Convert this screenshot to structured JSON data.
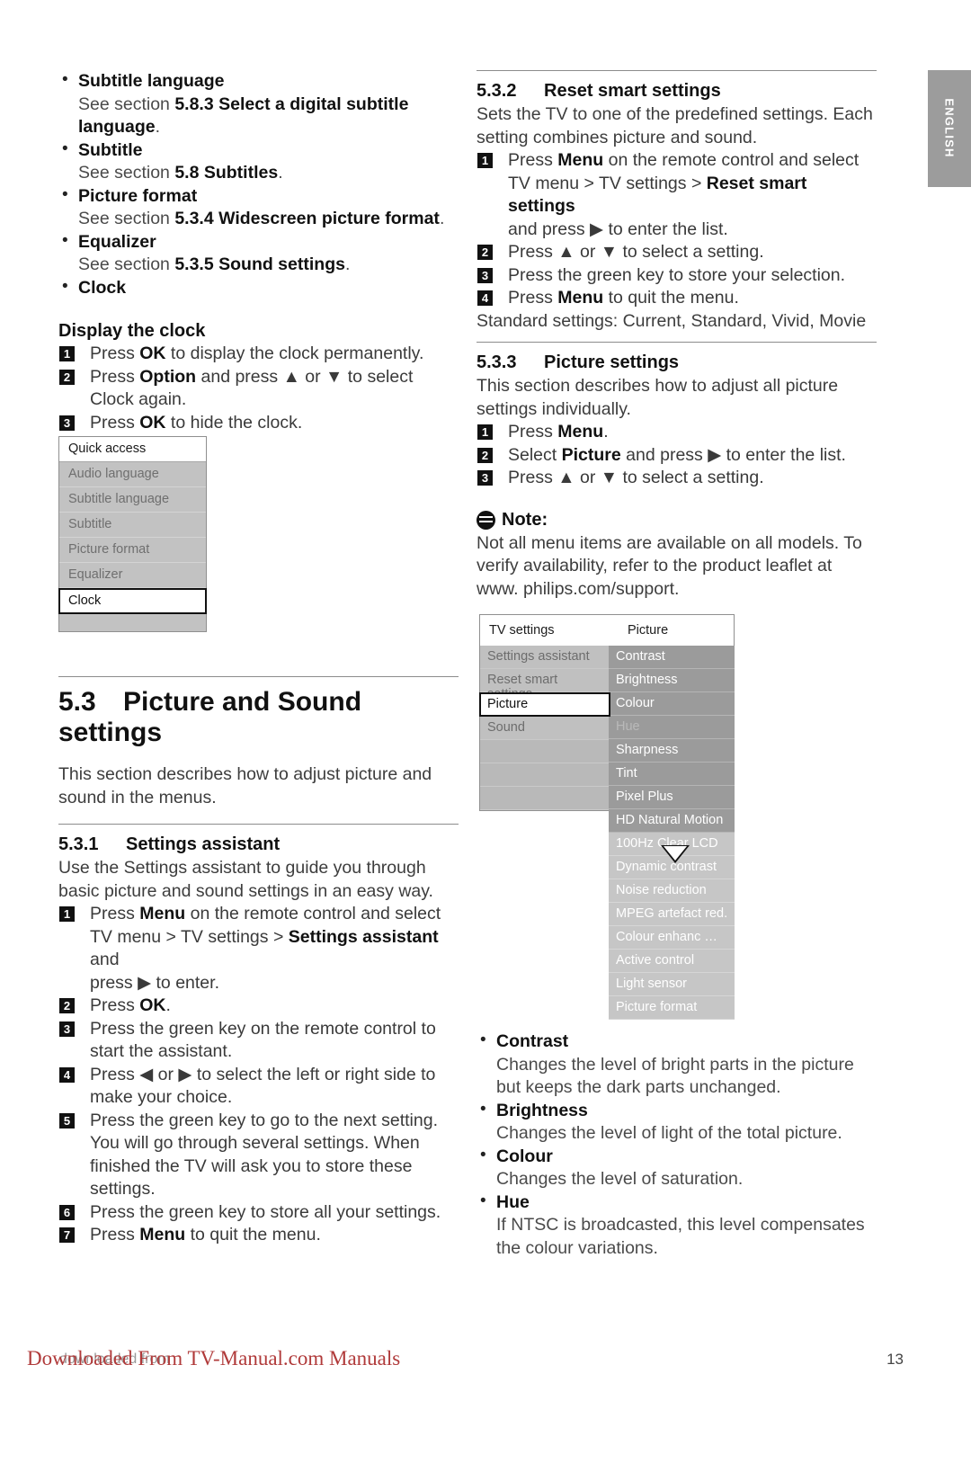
{
  "side_tab": {
    "label": "ENGLISH"
  },
  "left_column": {
    "top_bullets": [
      {
        "title": "Subtitle language",
        "sub_plain_1": "See section ",
        "sub_bold": "5.8.3 Select a digital subtitle language",
        "sub_plain_2": "."
      },
      {
        "title": "Subtitle",
        "sub_plain_1": "See section ",
        "sub_bold": "5.8 Subtitles",
        "sub_plain_2": "."
      },
      {
        "title": "Picture format",
        "sub_plain_1": "See section ",
        "sub_bold": "5.3.4 Widescreen picture format",
        "sub_plain_2": "."
      },
      {
        "title": "Equalizer",
        "sub_plain_1": "See section ",
        "sub_bold": "5.3.5 Sound settings",
        "sub_plain_2": "."
      },
      {
        "title": "Clock",
        "sub_plain_1": "",
        "sub_bold": "",
        "sub_plain_2": ""
      }
    ],
    "display_clock": {
      "heading": "Display the clock",
      "steps": [
        {
          "num": "1",
          "line1_a": "Press ",
          "line1_b": "OK",
          "line1_c": " to display the clock permanently."
        },
        {
          "num": "2",
          "line1_a": "Press ",
          "line1_b": "Option",
          "line1_c": " and press ▲ or ▼ to select",
          "line2": "Clock again."
        },
        {
          "num": "3",
          "line1_a": "Press ",
          "line1_b": "OK",
          "line1_c": " to hide the clock."
        }
      ]
    },
    "quick_access_menu": {
      "header": "Quick access",
      "items": [
        {
          "label": "Audio language",
          "selected": false
        },
        {
          "label": "Subtitle language",
          "selected": false
        },
        {
          "label": "Subtitle",
          "selected": false
        },
        {
          "label": "Picture format",
          "selected": false
        },
        {
          "label": "Equalizer",
          "selected": false
        },
        {
          "label": "Clock",
          "selected": true
        }
      ]
    },
    "section_53": {
      "number": "5.3",
      "title": "Picture and Sound settings",
      "intro": "This section describes how to adjust picture and sound in the menus."
    },
    "section_531": {
      "number": "5.3.1",
      "title": "Settings assistant",
      "intro": "Use the Settings assistant to guide you through basic picture and sound settings in an easy way.",
      "steps": [
        {
          "num": "1",
          "a": "Press ",
          "b": "Menu",
          "c": " on the remote control and select",
          "line2_a": "TV menu > TV settings > ",
          "line2_b": "Settings assistant",
          "line2_c": " and",
          "line3": "press ▶ to enter."
        },
        {
          "num": "2",
          "a": "Press ",
          "b": "OK",
          "c": "."
        },
        {
          "num": "3",
          "a": "Press the green key on the remote control to",
          "line2": "start the assistant."
        },
        {
          "num": "4",
          "a": "Press ◀ or ▶ to select the left or right side to",
          "line2": "make your choice."
        },
        {
          "num": "5",
          "a": "Press the green key to go to the next setting.",
          "line2": "You will go through several settings. When",
          "line3": "finished the TV will ask you to store these",
          "line4": "settings."
        },
        {
          "num": "6",
          "a": "Press the green key to store all your settings."
        },
        {
          "num": "7",
          "a": "Press ",
          "b": "Menu",
          "c": " to quit the menu."
        }
      ]
    }
  },
  "right_column": {
    "section_532": {
      "number": "5.3.2",
      "title": "Reset smart settings",
      "intro": "Sets the TV to one of the predefined settings. Each setting combines picture and sound.",
      "steps": [
        {
          "num": "1",
          "a": "Press ",
          "b": "Menu",
          "c": " on the remote control and select",
          "line2_a": "TV menu > TV settings > ",
          "line2_b": "Reset smart settings",
          "line3": "and press ▶ to enter the list."
        },
        {
          "num": "2",
          "a": "Press ▲ or ▼ to select a setting."
        },
        {
          "num": "3",
          "a": "Press the green key to store your selection."
        },
        {
          "num": "4",
          "a": "Press ",
          "b": "Menu",
          "c": " to quit the menu."
        }
      ],
      "footer": "Standard settings: Current, Standard, Vivid, Movie"
    },
    "section_533": {
      "number": "5.3.3",
      "title": "Picture settings",
      "intro": "This section describes how to adjust all picture settings individually.",
      "steps": [
        {
          "num": "1",
          "a": "Press ",
          "b": "Menu",
          "c": "."
        },
        {
          "num": "2",
          "a": "Select ",
          "b": "Picture",
          "c": " and press ▶ to enter the list."
        },
        {
          "num": "3",
          "a": "Press ▲ or ▼ to select a setting."
        }
      ]
    },
    "note": {
      "icon": "note-icon",
      "label": "Note",
      "colon": ":",
      "text": "Not all menu items are available on all models. To verify availability, refer to the product leaflet at www. philips.com/support."
    },
    "tv_settings_menu": {
      "header_left": "TV settings",
      "header_right": "Picture",
      "left_items": [
        {
          "label": "Settings assistant",
          "selected": false
        },
        {
          "label": "Reset smart settings",
          "selected": false
        },
        {
          "label": "Picture",
          "selected": true
        },
        {
          "label": "Sound",
          "selected": false
        }
      ],
      "right_items": [
        {
          "label": "Contrast",
          "state": "normal"
        },
        {
          "label": "Brightness",
          "state": "normal"
        },
        {
          "label": "Colour",
          "state": "normal"
        },
        {
          "label": "Hue",
          "state": "dim"
        },
        {
          "label": "Sharpness",
          "state": "normal"
        },
        {
          "label": "Tint",
          "state": "normal"
        },
        {
          "label": "Pixel Plus",
          "state": "normal"
        },
        {
          "label": "HD Natural Motion",
          "state": "normal"
        },
        {
          "label": "100Hz Clear LCD",
          "state": "pale"
        },
        {
          "label": "Dynamic contrast",
          "state": "pale"
        },
        {
          "label": "Noise reduction",
          "state": "pale"
        },
        {
          "label": "MPEG artefact red.",
          "state": "pale"
        },
        {
          "label": "Colour enhanc …",
          "state": "pale"
        },
        {
          "label": "Active control",
          "state": "pale"
        },
        {
          "label": "Light sensor",
          "state": "pale"
        },
        {
          "label": "Picture format",
          "state": "pale"
        }
      ],
      "scroll_indicator": "down-arrow"
    },
    "bottom_bullets": [
      {
        "title": "Contrast",
        "desc": "Changes the level of bright parts in the picture but keeps the dark parts unchanged."
      },
      {
        "title": "Brightness",
        "desc": "Changes the level of light of the total picture."
      },
      {
        "title": "Colour",
        "desc": "Changes the level of saturation."
      },
      {
        "title": "Hue",
        "desc": "If NTSC is broadcasted, this level compensates the colour variations."
      }
    ]
  },
  "footer": {
    "watermark": "Downloaded From TV-Manual.com Manuals",
    "watermark_grey": "downloaded from",
    "page_number": "13"
  }
}
